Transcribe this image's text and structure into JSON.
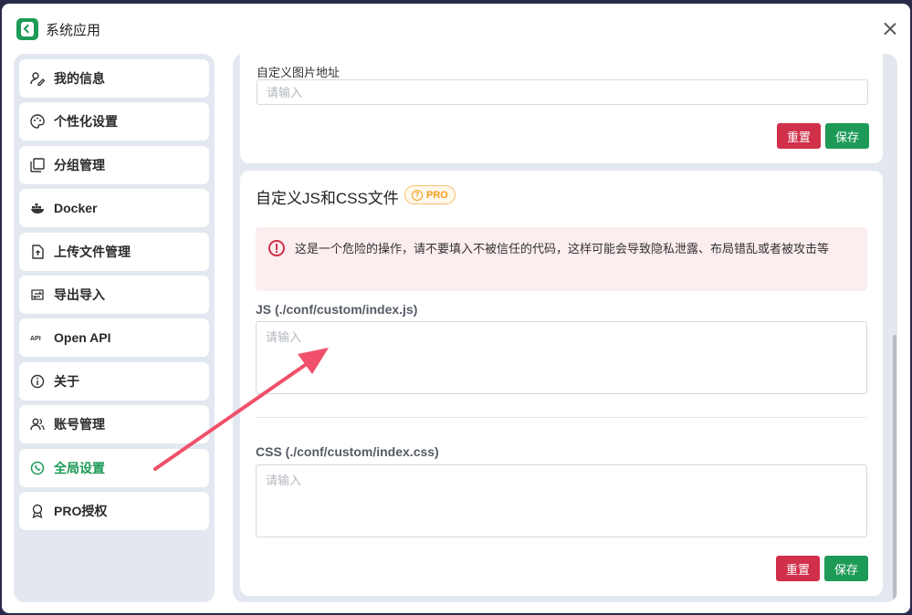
{
  "window": {
    "title": "系统应用"
  },
  "sidebar": {
    "items": [
      {
        "label": "我的信息",
        "icon": "user-edit-icon",
        "active": false
      },
      {
        "label": "个性化设置",
        "icon": "palette-icon",
        "active": false
      },
      {
        "label": "分组管理",
        "icon": "layers-icon",
        "active": false
      },
      {
        "label": "Docker",
        "icon": "docker-icon",
        "active": false
      },
      {
        "label": "上传文件管理",
        "icon": "file-upload-icon",
        "active": false
      },
      {
        "label": "导出导入",
        "icon": "import-export-icon",
        "active": false
      },
      {
        "label": "Open API",
        "icon": "api-icon",
        "active": false
      },
      {
        "label": "关于",
        "icon": "info-icon",
        "active": false
      },
      {
        "label": "账号管理",
        "icon": "users-icon",
        "active": false
      },
      {
        "label": "全局设置",
        "icon": "settings-icon",
        "active": true
      },
      {
        "label": "PRO授权",
        "icon": "award-icon",
        "active": false
      }
    ]
  },
  "image_section": {
    "label": "自定义图片地址",
    "placeholder": "请输入",
    "reset_label": "重置",
    "save_label": "保存"
  },
  "custom_section": {
    "title": "自定义JS和CSS文件",
    "badge": "PRO",
    "warning": "这是一个危险的操作，请不要填入不被信任的代码，这样可能会导致隐私泄露、布局错乱或者被攻击等",
    "js_label": "JS (./conf/custom/index.js)",
    "js_placeholder": "请输入",
    "css_label": "CSS (./conf/custom/index.css)",
    "css_placeholder": "请输入",
    "reset_label": "重置",
    "save_label": "保存"
  },
  "colors": {
    "accent": "#1e9a57",
    "danger": "#d0304a",
    "pro": "#f0a020"
  }
}
